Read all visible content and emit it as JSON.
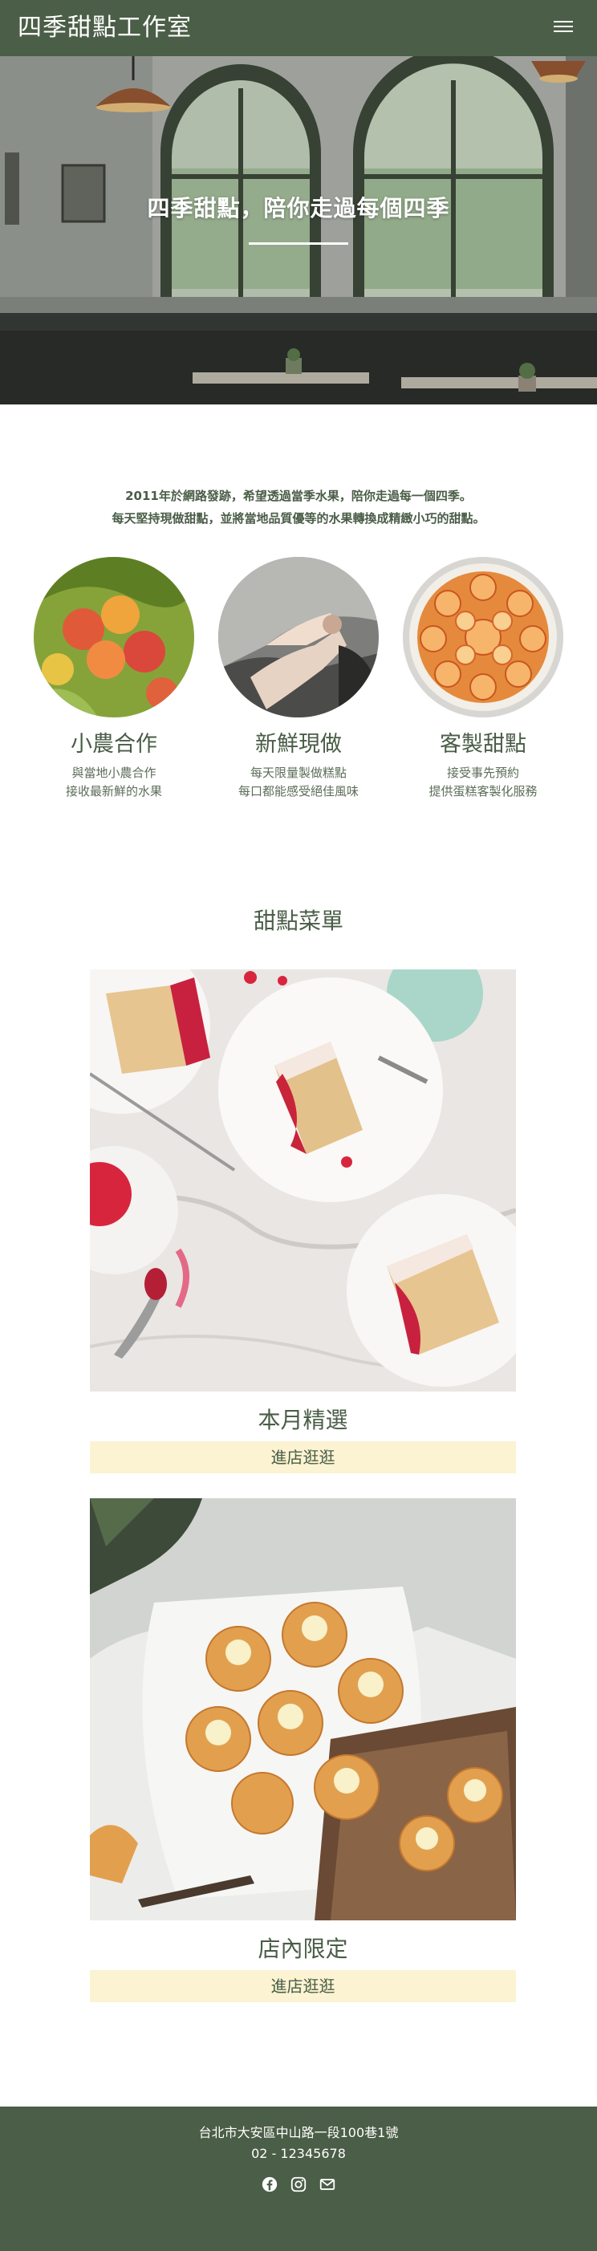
{
  "header": {
    "brand": "四季甜點工作室",
    "menu_icon": "hamburger-icon"
  },
  "hero": {
    "title": "四季甜點，陪你走過每個四季"
  },
  "intro": {
    "line1": "2011年於網路發跡，希望透過當季水果，陪你走過每一個四季。",
    "line2": "每天堅持現做甜點，並將當地品質優等的水果轉換成精緻小巧的甜點。"
  },
  "features": [
    {
      "title": "小農合作",
      "desc1": "與當地小農合作",
      "desc2": "接收最新鮮的水果"
    },
    {
      "title": "新鮮現做",
      "desc1": "每天限量製做糕點",
      "desc2": "每口都能感受絕佳風味"
    },
    {
      "title": "客製甜點",
      "desc1": "接受事先預約",
      "desc2": "提供蛋糕客製化服務"
    }
  ],
  "menu": {
    "title": "甜點菜單",
    "cards": [
      {
        "title": "本月精選",
        "button": "進店逛逛"
      },
      {
        "title": "店內限定",
        "button": "進店逛逛"
      }
    ]
  },
  "footer": {
    "address": "台北市大安區中山路一段100巷1號",
    "phone": "02 - 12345678",
    "social_icons": [
      "facebook-icon",
      "instagram-icon",
      "mail-icon"
    ]
  },
  "colors": {
    "primary": "#4b5e47",
    "button_bg": "#fbf3d2",
    "text": "#4a5d47"
  }
}
